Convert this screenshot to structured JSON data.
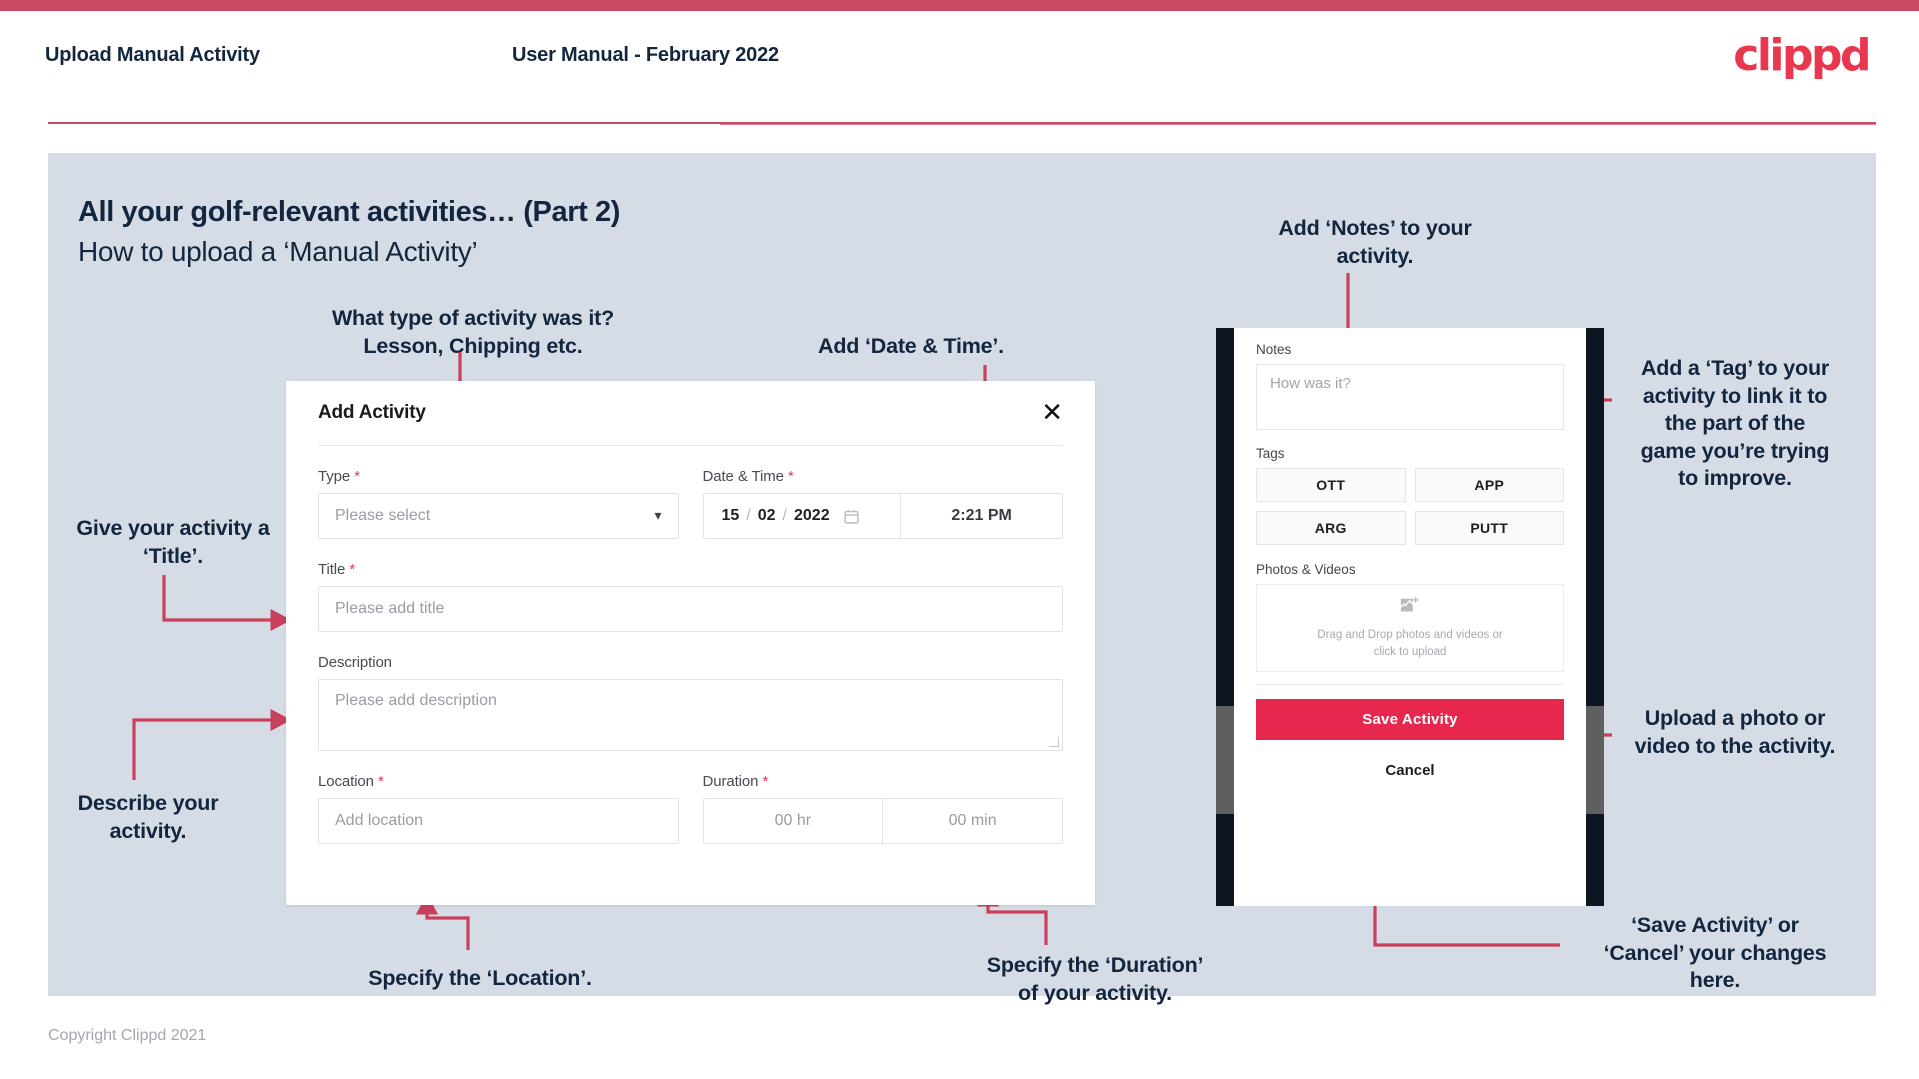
{
  "header": {
    "left_title": "Upload Manual Activity",
    "center_title": "User Manual - February 2022",
    "logo": "clippd"
  },
  "slide": {
    "title": "All your golf-relevant activities… (Part 2)",
    "subtitle": "How to upload a ‘Manual Activity’"
  },
  "annotations": {
    "type": "What type of activity was it?\nLesson, Chipping etc.",
    "datetime": "Add ‘Date & Time’.",
    "notes": "Add ‘Notes’ to your\nactivity.",
    "tag": "Add a ‘Tag’ to your\nactivity to link it to\nthe part of the\ngame you’re trying\nto improve.",
    "title_field": "Give your activity a\n‘Title’.",
    "description": "Describe your\nactivity.",
    "location": "Specify the ‘Location’.",
    "duration": "Specify the ‘Duration’\nof your activity.",
    "upload": "Upload a photo or\nvideo to the activity.",
    "save_cancel": "‘Save Activity’ or\n‘Cancel’ your changes\nhere."
  },
  "dialog": {
    "title": "Add Activity",
    "close_icon": "✕",
    "fields": {
      "type_label": "Type",
      "type_placeholder": "Please select",
      "datetime_label": "Date & Time",
      "date_day": "15",
      "date_month": "02",
      "date_year": "2022",
      "date_sep": "/",
      "time_value": "2:21 PM",
      "title_label": "Title",
      "title_placeholder": "Please add title",
      "description_label": "Description",
      "description_placeholder": "Please add description",
      "location_label": "Location",
      "location_placeholder": "Add location",
      "duration_label": "Duration",
      "duration_hr": "00 hr",
      "duration_min": "00 min",
      "required_mark": "*"
    }
  },
  "phone": {
    "notes_label": "Notes",
    "notes_placeholder": "How was it?",
    "tags_label": "Tags",
    "tags": [
      "OTT",
      "APP",
      "ARG",
      "PUTT"
    ],
    "photos_label": "Photos & Videos",
    "dropzone_line1": "Drag and Drop photos and videos or",
    "dropzone_line2": "click to upload",
    "save_label": "Save Activity",
    "cancel_label": "Cancel"
  },
  "footer": {
    "copyright": "Copyright Clippd 2021"
  },
  "colors": {
    "brand_red": "#e8374f",
    "topbar": "#c94a63",
    "panel_bg": "#d6dce5",
    "arrow": "#c8405c",
    "text_dark": "#12263f",
    "save_button": "#e8274f"
  }
}
